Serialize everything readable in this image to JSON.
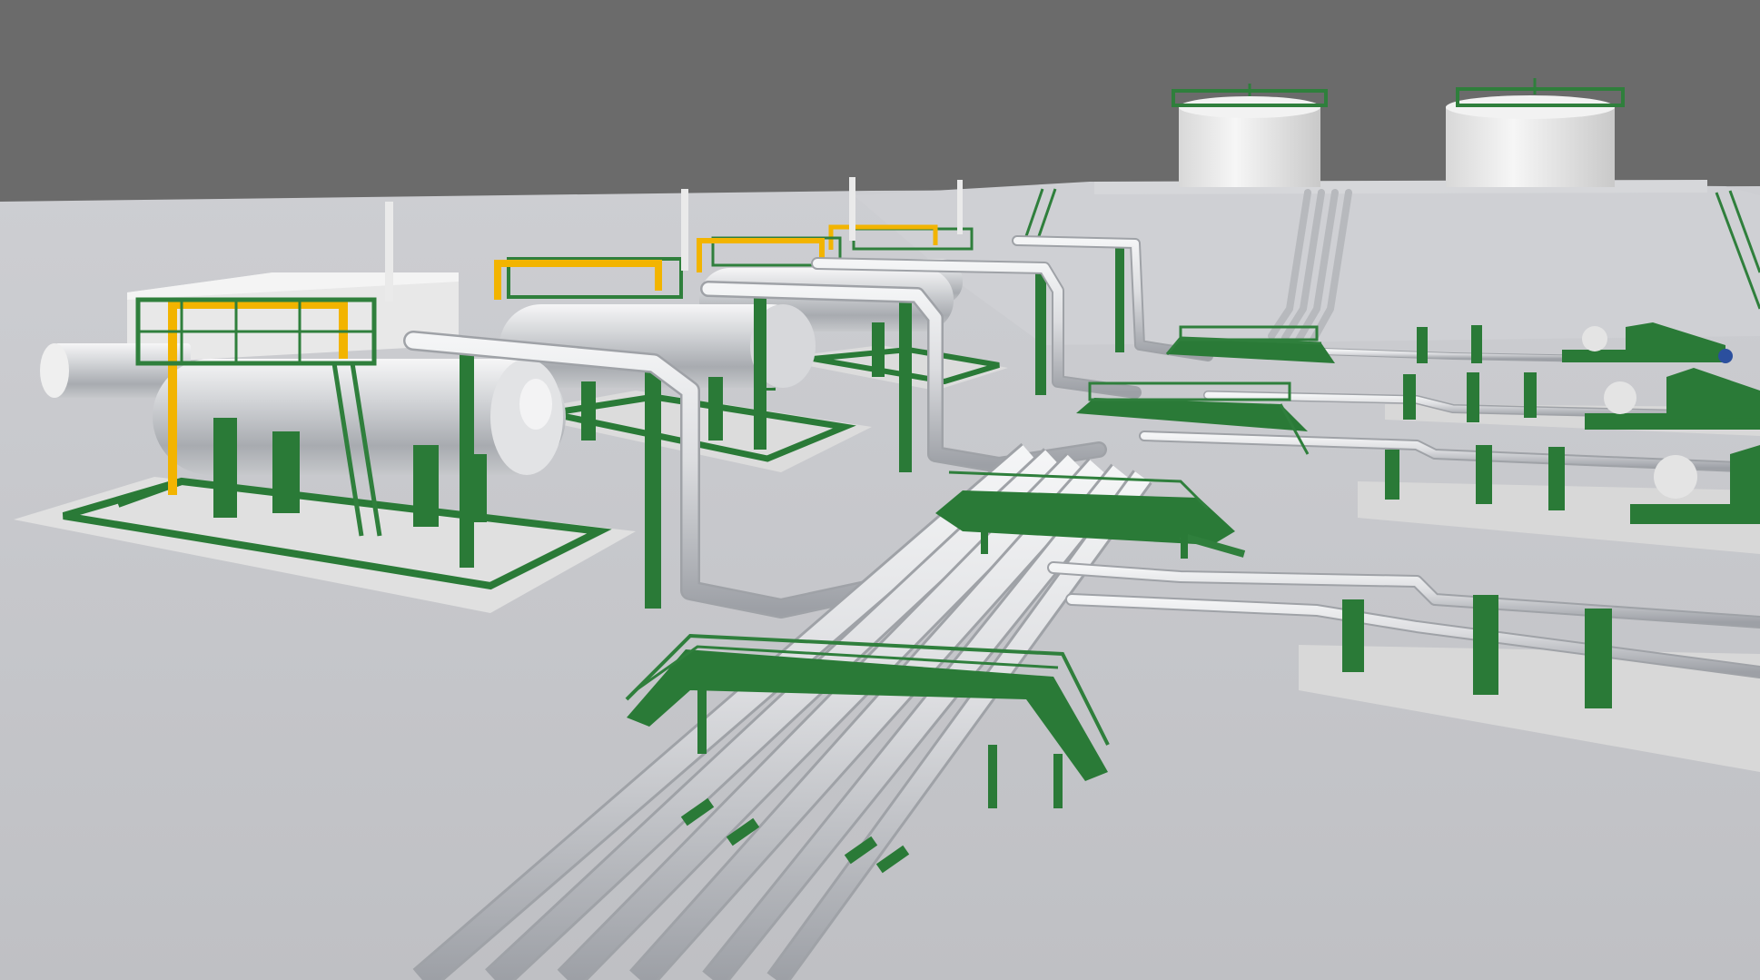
{
  "scene": {
    "subject": "industrial-pipeline-facility-3d-render",
    "colors": {
      "sky": "#6b6b6b",
      "ground": "#c6c7cb",
      "ground_far": "#c9cace",
      "slab": "#dfdfdf",
      "steel_green": "#2f7f3c",
      "steel_green_dark": "#1f5e2b",
      "pipe": "#d9dadd",
      "pipe_shadow": "#9fa2a7",
      "rail_yellow": "#f2b400",
      "tank_white": "#ececec"
    },
    "vessels": [
      {
        "name": "separator-1"
      },
      {
        "name": "separator-2"
      },
      {
        "name": "separator-3"
      },
      {
        "name": "separator-4"
      }
    ],
    "storage_tanks": [
      {
        "name": "storage-tank-left"
      },
      {
        "name": "storage-tank-right"
      }
    ],
    "walkways": [
      {
        "name": "walkway-front"
      },
      {
        "name": "walkway-middle"
      },
      {
        "name": "walkway-back"
      }
    ],
    "pump_skids": [
      {
        "name": "pump-skid-1"
      },
      {
        "name": "pump-skid-2"
      },
      {
        "name": "pump-skid-3"
      }
    ]
  }
}
